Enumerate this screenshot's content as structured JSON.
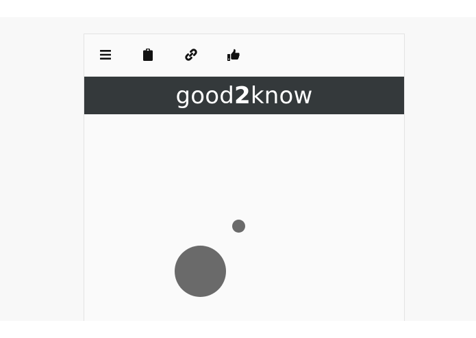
{
  "toolbar": {
    "items": [
      {
        "name": "menu",
        "icon": "hamburger-menu-icon"
      },
      {
        "name": "clipboard",
        "icon": "clipboard-icon"
      },
      {
        "name": "link",
        "icon": "link-icon"
      },
      {
        "name": "like",
        "icon": "thumbs-up-icon"
      }
    ]
  },
  "banner": {
    "logo_part1": "good",
    "logo_part2": "2",
    "logo_part3": "know"
  },
  "colors": {
    "banner_bg": "#34393b",
    "logo_text": "#ffffff",
    "dot": "#6a6a6a",
    "icon": "#111111"
  }
}
